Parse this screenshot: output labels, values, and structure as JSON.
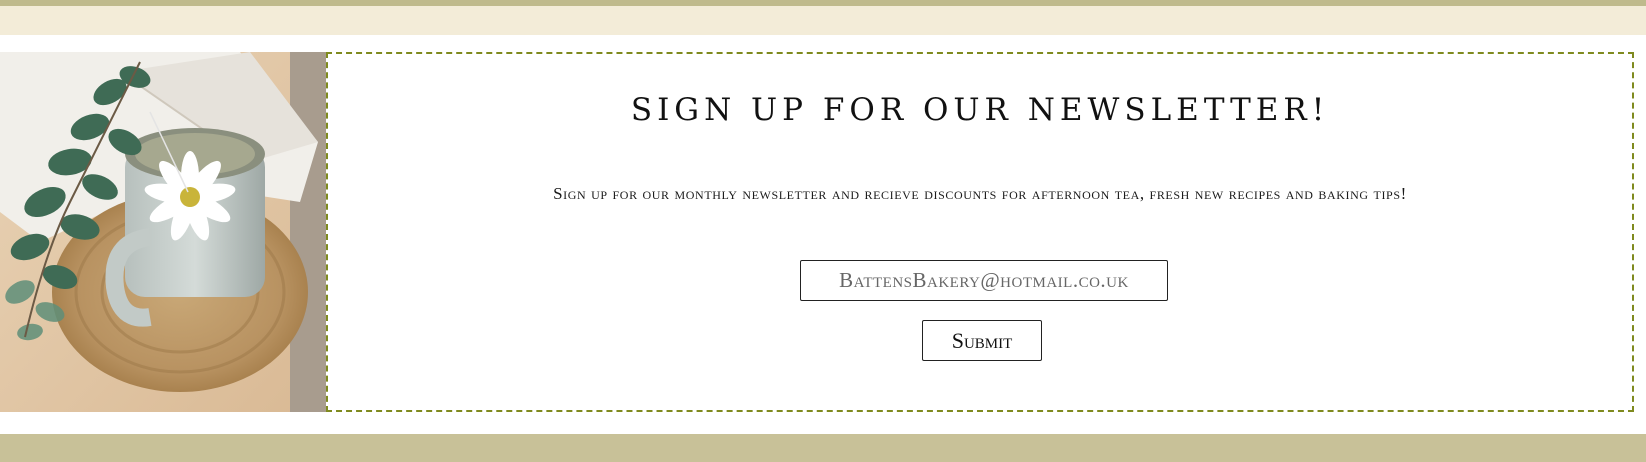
{
  "colors": {
    "top_strip": "#bfba8c",
    "top_band": "#f3ecd8",
    "bottom_band": "#c8c198",
    "panel_border": "#7f8a1f"
  },
  "newsletter": {
    "heading": "Sign up for our newsletter!",
    "description": "Sign up for our monthly newsletter and recieve discounts for afternoon tea, fresh new recipes and baking tips!",
    "email_placeholder": "BattensBakery@hotmail.co.uk",
    "submit_label": "Submit"
  }
}
